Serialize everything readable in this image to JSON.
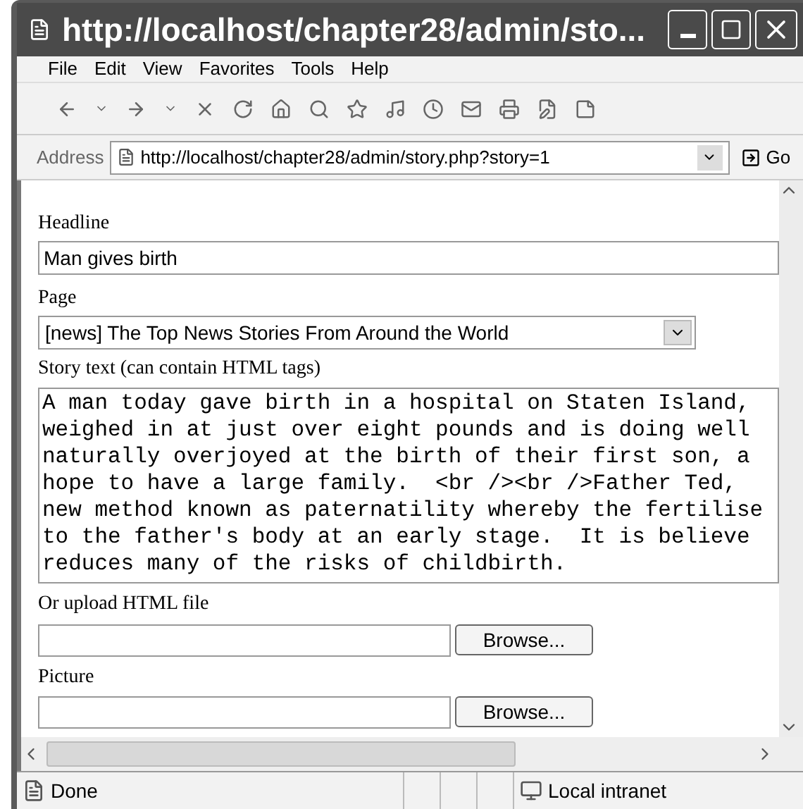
{
  "window": {
    "title": "http://localhost/chapter28/admin/sto..."
  },
  "menu": [
    "File",
    "Edit",
    "View",
    "Favorites",
    "Tools",
    "Help"
  ],
  "address": {
    "label": "Address",
    "url": "http://localhost/chapter28/admin/story.php?story=1",
    "go": "Go"
  },
  "form": {
    "headline": {
      "label": "Headline",
      "value": "Man gives birth"
    },
    "page": {
      "label": "Page",
      "value": "[news] The Top News Stories From Around the World"
    },
    "story": {
      "label": "Story text (can contain HTML tags)",
      "lines": [
        "A man today gave birth in a hospital on Staten Island,",
        "weighed in at just over eight pounds and is doing well",
        "naturally overjoyed at the birth of their first son, a",
        "hope to have a large family.  <br /><br />Father Ted,",
        "new method known as paternatility whereby the fertilise",
        "to the father's body at an early stage.  It is believe",
        "reduces many of the risks of childbirth."
      ]
    },
    "upload": {
      "label": "Or upload HTML file",
      "button": "Browse..."
    },
    "picture": {
      "label": "Picture",
      "button": "Browse..."
    }
  },
  "status_bar": {
    "text": "Done",
    "zone": "Local intranet"
  }
}
